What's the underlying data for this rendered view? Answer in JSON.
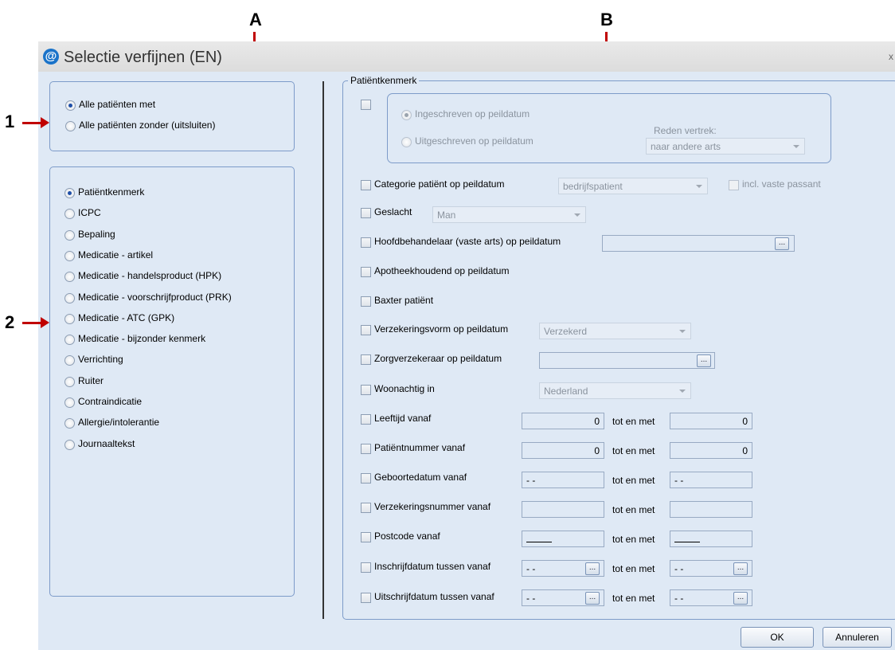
{
  "annotations": {
    "a": "A",
    "b": "B",
    "one": "1",
    "two": "2"
  },
  "window": {
    "title": "Selectie verfijnen (EN)",
    "close": "x",
    "icon": "at-icon"
  },
  "scope": {
    "options": [
      "Alle patiënten met",
      "Alle patiënten zonder (uitsluiten)"
    ],
    "selected": 0
  },
  "criteria": {
    "options": [
      "Patiëntkenmerk",
      "ICPC",
      "Bepaling",
      "Medicatie - artikel",
      "Medicatie - handelsproduct (HPK)",
      "Medicatie - voorschrijfproduct (PRK)",
      "Medicatie - ATC (GPK)",
      "Medicatie - bijzonder kenmerk",
      "Verrichting",
      "Ruiter",
      "Contraindicatie",
      "Allergie/intolerantie",
      "Journaaltekst"
    ],
    "selected": 0
  },
  "group": {
    "legend": "Patiëntkenmerk",
    "registration": {
      "ingeschreven": "Ingeschreven op peildatum",
      "uitgeschreven": "Uitgeschreven op peildatum",
      "reden_label": "Reden vertrek:",
      "reden_value": "naar andere arts"
    },
    "categorie": {
      "label": "Categorie patiënt op peildatum",
      "value": "bedrijfspatient",
      "incl": "incl. vaste passant"
    },
    "geslacht": {
      "label": "Geslacht",
      "value": "Man"
    },
    "hoofdbehandelaar": {
      "label": "Hoofdbehandelaar (vaste arts) op peildatum",
      "value": ""
    },
    "apotheek": {
      "label": "Apotheekhoudend op peildatum"
    },
    "baxter": {
      "label": "Baxter patiënt"
    },
    "verzekeringsvorm": {
      "label": "Verzekeringsvorm op peildatum",
      "value": "Verzekerd"
    },
    "zorgverzekeraar": {
      "label": "Zorgverzekeraar op peildatum",
      "value": ""
    },
    "woonachtig": {
      "label": "Woonachtig in",
      "value": "Nederland"
    },
    "tot_en_met": "tot en met",
    "leeftijd": {
      "label": "Leeftijd vanaf",
      "from": "0",
      "to": "0"
    },
    "patientnummer": {
      "label": "Patiëntnummer vanaf",
      "from": "0",
      "to": "0"
    },
    "geboortedatum": {
      "label": "Geboortedatum vanaf",
      "from": "- -",
      "to": "- -"
    },
    "verzekeringsnummer": {
      "label": "Verzekeringsnummer vanaf",
      "from": "",
      "to": ""
    },
    "postcode": {
      "label": "Postcode vanaf",
      "from": "",
      "to": ""
    },
    "inschrijfdatum": {
      "label": "Inschrijfdatum tussen vanaf",
      "from": "- -",
      "to": "- -"
    },
    "uitschrijfdatum": {
      "label": "Uitschrijfdatum tussen vanaf",
      "from": "- -",
      "to": "- -"
    }
  },
  "buttons": {
    "ellipsis": "...",
    "ok": "OK",
    "cancel": "Annuleren"
  }
}
